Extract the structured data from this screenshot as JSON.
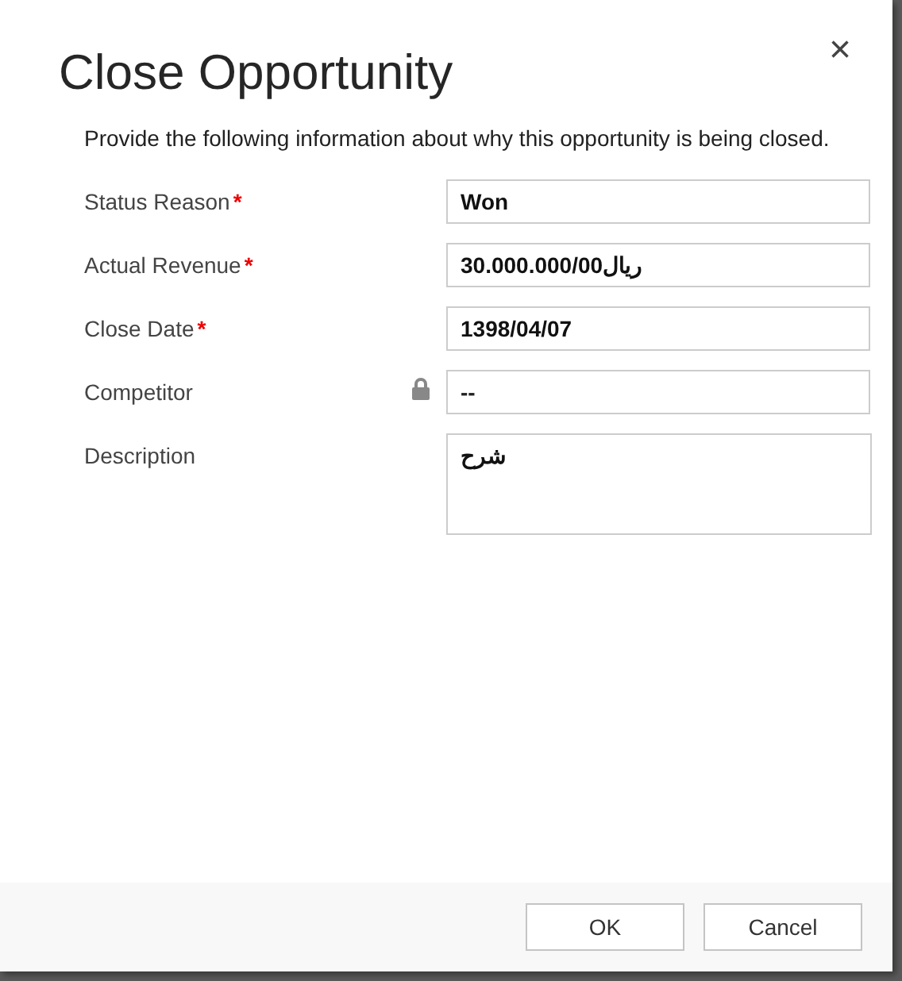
{
  "dialog": {
    "title": "Close Opportunity",
    "close_glyph": "×",
    "intro": "Provide the following information about why this opportunity is being closed."
  },
  "fields": [
    {
      "label": "Status Reason",
      "required": true,
      "locked": false,
      "kind": "line",
      "value": "Won"
    },
    {
      "label": "Actual Revenue",
      "required": true,
      "locked": false,
      "kind": "line",
      "value": "30.000.000/00ریال"
    },
    {
      "label": "Close Date",
      "required": true,
      "locked": false,
      "kind": "line",
      "value": "1398/04/07"
    },
    {
      "label": "Competitor",
      "required": false,
      "locked": true,
      "kind": "line",
      "value": "--"
    },
    {
      "label": "Description",
      "required": false,
      "locked": false,
      "kind": "multiline",
      "value": "شرح"
    }
  ],
  "required_mark": "*",
  "buttons": [
    "OK",
    "Cancel"
  ]
}
